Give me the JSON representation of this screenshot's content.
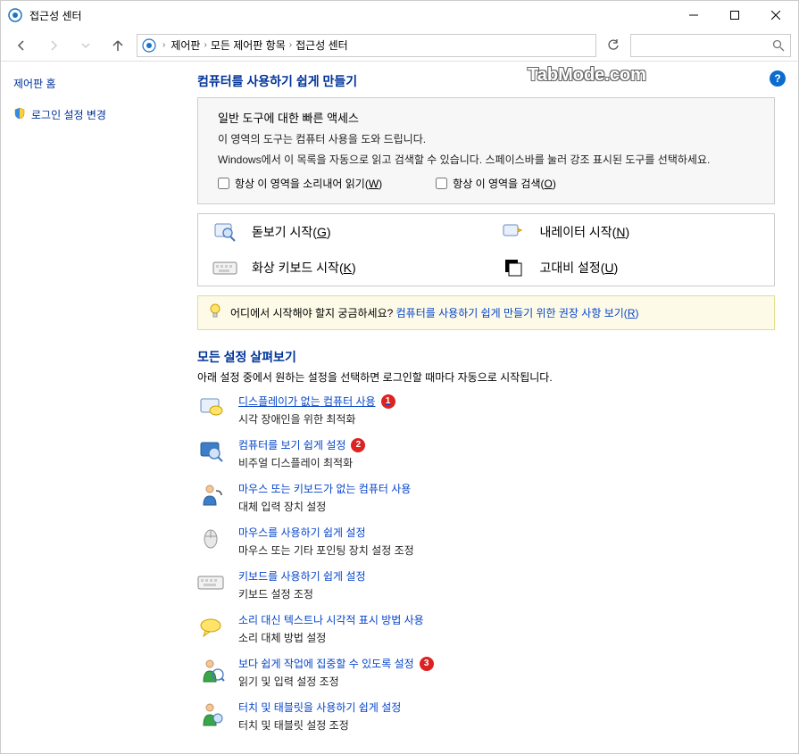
{
  "window": {
    "title": "접근성 센터"
  },
  "breadcrumb": {
    "root": "제어판",
    "mid": "모든 제어판 항목",
    "leaf": "접근성 센터"
  },
  "sidebar": {
    "home": "제어판 홈",
    "login": "로그인 설정 변경"
  },
  "watermark": "TabMode.com",
  "mainTitle": "컴퓨터를 사용하기 쉽게 만들기",
  "quickAccess": {
    "title": "일반 도구에 대한 빠른 액세스",
    "desc1": "이 영역의 도구는 컴퓨터 사용을 도와 드립니다.",
    "desc2": "Windows에서 이 목록을 자동으로 읽고 검색할 수 있습니다. 스페이스바를 눌러 강조 표시된 도구를 선택하세요.",
    "check1_pre": "항상 이 영역을 소리내어 읽기(",
    "check1_hot": "W",
    "check1_post": ")",
    "check2_pre": "항상 이 영역을 검색(",
    "check2_hot": "O",
    "check2_post": ")"
  },
  "tools": {
    "magnifier_pre": "돋보기 시작(",
    "magnifier_hot": "G",
    "magnifier_post": ")",
    "narrator_pre": "내레이터 시작(",
    "narrator_hot": "N",
    "narrator_post": ")",
    "osk_pre": "화상 키보드 시작(",
    "osk_hot": "K",
    "osk_post": ")",
    "contrast_pre": "고대비 설정(",
    "contrast_hot": "U",
    "contrast_post": ")"
  },
  "tip": {
    "question": "어디에서 시작해야 할지 궁금하세요?",
    "link_pre": "컴퓨터를 사용하기 쉽게 만들기 위한 권장 사항 보기(",
    "link_hot": "R",
    "link_post": ")"
  },
  "explore": {
    "title": "모든 설정 살펴보기",
    "desc": "아래 설정 중에서 원하는 설정을 선택하면 로그인할 때마다 자동으로 시작됩니다."
  },
  "opts": [
    {
      "link": "디스플레이가 없는 컴퓨터 사용",
      "desc": "시각 장애인을 위한 최적화",
      "badge": "1",
      "underline": true
    },
    {
      "link": "컴퓨터를 보기 쉽게 설정",
      "desc": "비주얼 디스플레이 최적화",
      "badge": "2"
    },
    {
      "link": "마우스 또는 키보드가 없는 컴퓨터 사용",
      "desc": "대체 입력 장치 설정"
    },
    {
      "link": "마우스를 사용하기 쉽게 설정",
      "desc": "마우스 또는 기타 포인팅 장치 설정 조정"
    },
    {
      "link": "키보드를 사용하기 쉽게 설정",
      "desc": "키보드 설정 조정"
    },
    {
      "link": "소리 대신 텍스트나 시각적 표시 방법 사용",
      "desc": "소리 대체 방법 설정"
    },
    {
      "link": "보다 쉽게 작업에 집중할 수 있도록 설정",
      "desc": "읽기 및 입력 설정 조정",
      "badge": "3"
    },
    {
      "link": "터치 및 태블릿을 사용하기 쉽게 설정",
      "desc": "터치 및 태블릿 설정 조정"
    }
  ]
}
